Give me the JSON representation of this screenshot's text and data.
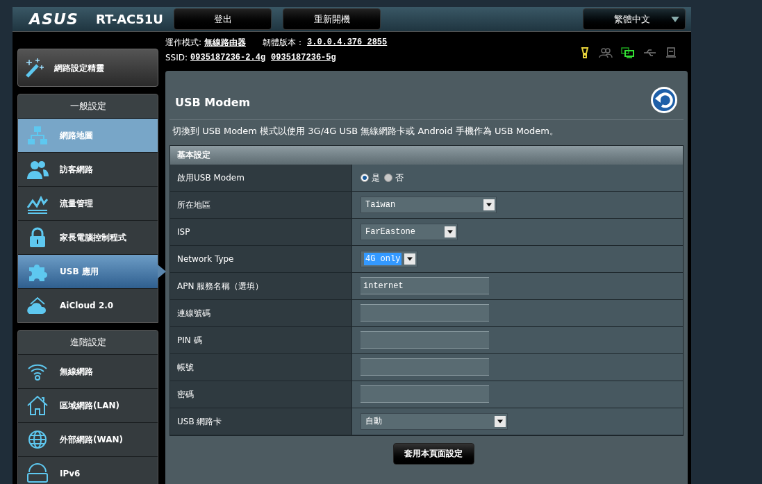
{
  "header": {
    "brand": "ASUS",
    "model": "RT-AC51U",
    "buttons": [
      "登出",
      "重新開機"
    ],
    "language": "繁體中文"
  },
  "info": {
    "mode_label": "運作模式:",
    "mode": "無線路由器",
    "firmware_label": "韌體版本：",
    "firmware": "3.0.0.4.376_2855",
    "ssid_label": "SSID:",
    "ssids": [
      "0935187236-2.4g",
      "0935187236-5g"
    ]
  },
  "wizard": "網路設定精靈",
  "sidebar": [
    {
      "title": "一般設定",
      "items": [
        {
          "label": "網路地圖",
          "selected": false,
          "hover": true
        },
        {
          "label": "訪客網路",
          "selected": false,
          "hover": false
        },
        {
          "label": "流量管理",
          "selected": false,
          "hover": false
        },
        {
          "label": "家長電腦控制程式",
          "selected": false,
          "hover": false
        },
        {
          "label": "USB 應用",
          "selected": true,
          "hover": false
        },
        {
          "label": "AiCloud 2.0",
          "selected": false,
          "hover": false
        }
      ]
    },
    {
      "title": "進階設定",
      "items": [
        {
          "label": "無線網路",
          "selected": false,
          "hover": false
        },
        {
          "label": "區域網路(LAN)",
          "selected": false,
          "hover": false
        },
        {
          "label": "外部網路(WAN)",
          "selected": false,
          "hover": false
        },
        {
          "label": "IPv6",
          "selected": false,
          "hover": false
        }
      ]
    }
  ],
  "page": {
    "title": "USB Modem",
    "description": "切換到 USB Modem 模式以使用 3G/4G USB 無線網路卡或 Android 手機作為 USB Modem。",
    "section": "基本設定",
    "rows": [
      {
        "kind": "radio",
        "label": "啟用USB Modem",
        "options": [
          {
            "label": "是",
            "selected": true
          },
          {
            "label": "否",
            "selected": false
          }
        ]
      },
      {
        "kind": "select",
        "label": "所在地區",
        "value": "Taiwan",
        "focused": false
      },
      {
        "kind": "select",
        "label": "ISP",
        "value": "FarEastone",
        "focused": false
      },
      {
        "kind": "select",
        "label": "Network Type",
        "value": "4G only",
        "focused": true
      },
      {
        "kind": "text",
        "label": "APN 服務名稱（選填）",
        "value": "internet"
      },
      {
        "kind": "text",
        "label": "連線號碼",
        "value": ""
      },
      {
        "kind": "text",
        "label": "PIN 碼",
        "value": ""
      },
      {
        "kind": "text",
        "label": "帳號",
        "value": ""
      },
      {
        "kind": "text",
        "label": "密碼",
        "value": ""
      },
      {
        "kind": "select",
        "label": "USB 網路卡",
        "value": "自動",
        "focused": false
      }
    ],
    "apply": "套用本頁面設定"
  }
}
